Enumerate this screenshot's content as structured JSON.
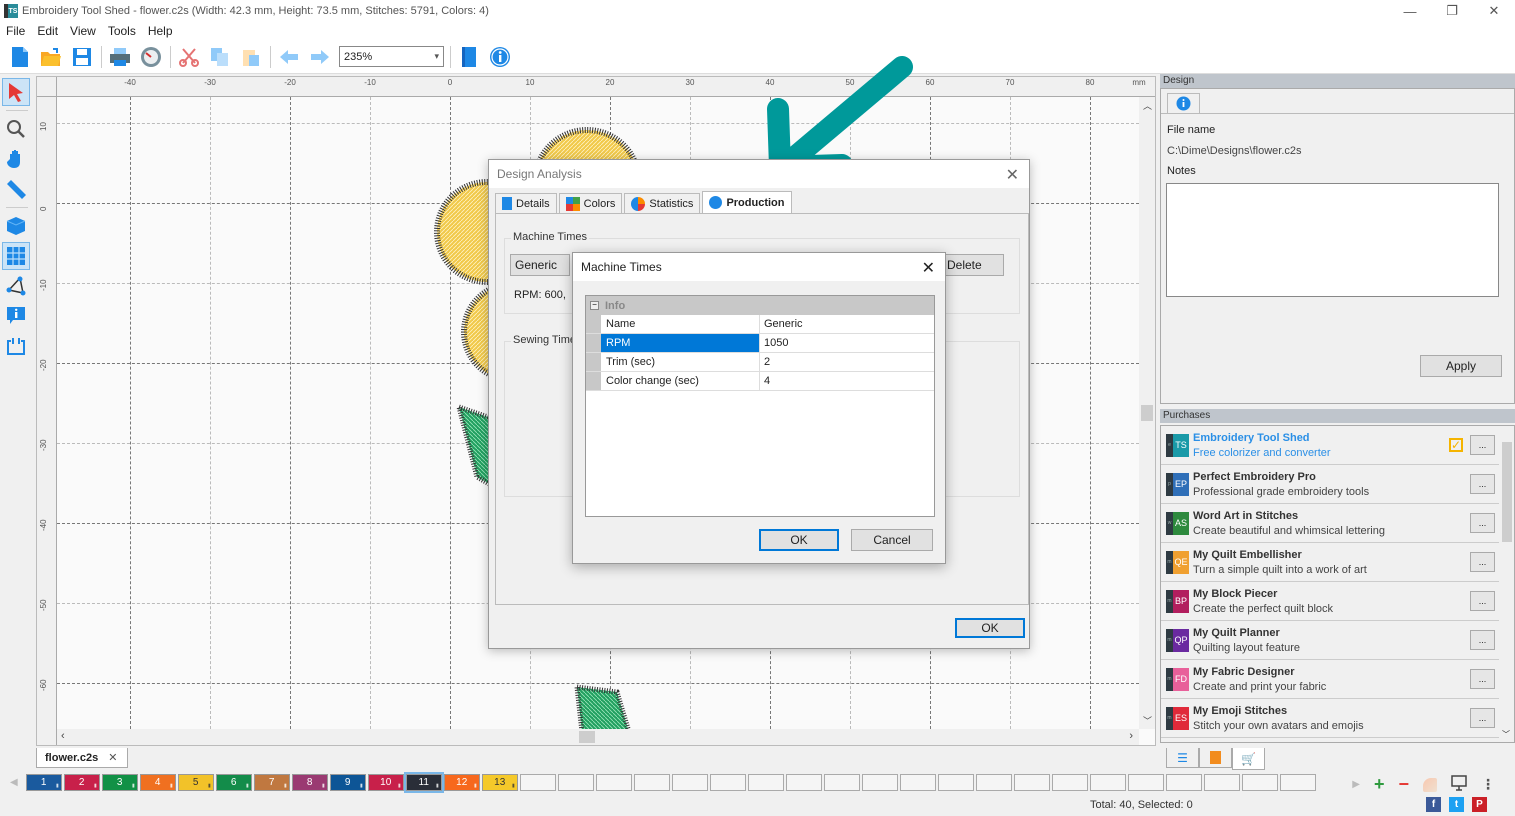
{
  "window": {
    "title": "Embroidery Tool Shed - flower.c2s (Width: 42.3 mm, Height: 73.5 mm, Stitches: 5791, Colors: 4)",
    "app_icon_label": "TS",
    "minimize": "—",
    "restore": "❐",
    "close": "✕"
  },
  "menu": [
    "File",
    "Edit",
    "View",
    "Tools",
    "Help"
  ],
  "toolbar": {
    "zoom_value": "235%",
    "icons": [
      "new-file-icon",
      "open-folder-icon",
      "save-icon",
      "print-icon",
      "machine-gauge-icon",
      "cut-icon",
      "copy-icon",
      "paste-icon",
      "undo-arrow-icon",
      "redo-arrow-icon",
      "hoop-icon",
      "info-icon"
    ]
  },
  "tools": [
    "select-arrow-icon",
    "zoom-magnifier-icon",
    "pan-hand-icon",
    "measure-ruler-icon",
    "3d-cube-icon",
    "grid-icon",
    "polygon-node-icon",
    "info-bubble-icon",
    "hoop-frame-icon"
  ],
  "ruler": {
    "top_labels": [
      "-40",
      "-30",
      "-20",
      "-10",
      "0",
      "10",
      "20",
      "30",
      "40",
      "50",
      "60",
      "70",
      "80"
    ],
    "left_labels": [
      "10",
      "0",
      "-10",
      "-20",
      "-30",
      "-40",
      "-50",
      "-60"
    ],
    "unit": "mm"
  },
  "document_tab": {
    "label": "flower.c2s",
    "close": "✕"
  },
  "palette": {
    "swatches": [
      {
        "num": "1",
        "color": "#1a5a9e"
      },
      {
        "num": "2",
        "color": "#c8204a"
      },
      {
        "num": "3",
        "color": "#119146"
      },
      {
        "num": "4",
        "color": "#f07020"
      },
      {
        "num": "5",
        "color": "#f2c229"
      },
      {
        "num": "6",
        "color": "#138c4a"
      },
      {
        "num": "7",
        "color": "#c07840"
      },
      {
        "num": "8",
        "color": "#9a3a72"
      },
      {
        "num": "9",
        "color": "#0d5596"
      },
      {
        "num": "10",
        "color": "#c8204a"
      },
      {
        "num": "11",
        "color": "#2a2e38"
      },
      {
        "num": "12",
        "color": "#f7681d"
      },
      {
        "num": "13",
        "color": "#f5c92a"
      }
    ],
    "selected": "11",
    "empty_count": 21
  },
  "status": {
    "text": "Total: 40, Selected: 0"
  },
  "design_panel": {
    "header": "Design",
    "file_name_label": "File name",
    "file_path": "C:\\Dime\\Designs\\flower.c2s",
    "notes_label": "Notes",
    "notes_value": "",
    "apply_label": "Apply"
  },
  "purchases": {
    "header": "Purchases",
    "items": [
      {
        "prefix": "e",
        "abbr": "TS",
        "color": "#1a9aa8",
        "title": "Embroidery Tool Shed",
        "desc": "Free colorizer and converter",
        "owned": true
      },
      {
        "prefix": "p",
        "abbr": "EP",
        "color": "#2f6fb8",
        "title": "Perfect Embroidery Pro",
        "desc": "Professional grade embroidery tools",
        "owned": false
      },
      {
        "prefix": "w",
        "abbr": "AS",
        "color": "#2e8a3e",
        "title": "Word Art in Stitches",
        "desc": "Create beautiful and whimsical lettering",
        "owned": false
      },
      {
        "prefix": "m",
        "abbr": "QE",
        "color": "#f0a030",
        "title": "My Quilt Embellisher",
        "desc": "Turn a simple quilt into a work of art",
        "owned": false
      },
      {
        "prefix": "m",
        "abbr": "BP",
        "color": "#b21e5e",
        "title": "My Block Piecer",
        "desc": "Create the perfect quilt block",
        "owned": false
      },
      {
        "prefix": "m",
        "abbr": "QP",
        "color": "#6a2aa0",
        "title": "My Quilt Planner",
        "desc": "Quilting layout feature",
        "owned": false
      },
      {
        "prefix": "m",
        "abbr": "FD",
        "color": "#e8609a",
        "title": "My Fabric Designer",
        "desc": "Create and print your fabric",
        "owned": false
      },
      {
        "prefix": "m",
        "abbr": "ES",
        "color": "#e02a3a",
        "title": "My Emoji Stitches",
        "desc": "Stitch your own avatars and emojis",
        "owned": false
      }
    ],
    "more_label": "..."
  },
  "design_analysis": {
    "title": "Design Analysis",
    "tabs": [
      {
        "label": "Details",
        "icon": "document-icon"
      },
      {
        "label": "Colors",
        "icon": "color-squares-icon"
      },
      {
        "label": "Statistics",
        "icon": "pie-chart-icon"
      },
      {
        "label": "Production",
        "icon": "stopwatch-icon",
        "active": true
      }
    ],
    "machine_times_label": "Machine Times",
    "machine_select": "Generic",
    "delete_label": "Delete",
    "rpm_summary": "RPM: 600,",
    "sewing_time_label": "Sewing Time",
    "ok_label": "OK"
  },
  "machine_times_dialog": {
    "title": "Machine Times",
    "category": "Info",
    "rows": [
      {
        "name": "Name",
        "value": "Generic"
      },
      {
        "name": "RPM",
        "value": "1050",
        "selected": true
      },
      {
        "name": "Trim (sec)",
        "value": "2"
      },
      {
        "name": "Color change (sec)",
        "value": "4"
      }
    ],
    "ok_label": "OK",
    "cancel_label": "Cancel"
  },
  "annotation": {
    "arrow_color": "#00999a"
  }
}
